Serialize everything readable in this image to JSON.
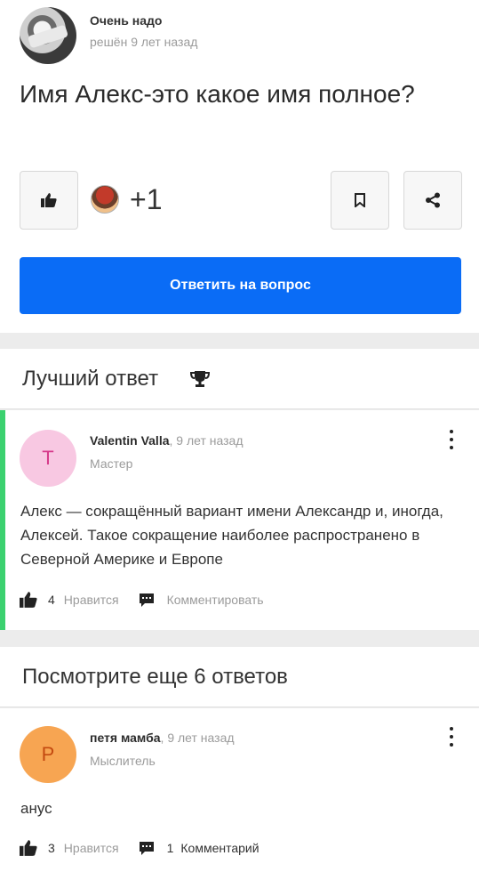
{
  "question": {
    "author": "Очень надо",
    "time": "решён 9 лет назад",
    "title": "Имя Алекс-это какое имя полное?",
    "likes_extra": "+1",
    "answer_button": "Ответить на вопрос"
  },
  "best": {
    "header": "Лучший ответ",
    "avatar_letter": "T",
    "author": "Valentin Valla",
    "time": ", 9 лет назад",
    "rank": "Мастер",
    "text": "Алекс — сокращённый вариант имени Александр и, иногда, Алексей. Такое сокращение наиболее распространено в Северной Америке и Европе",
    "like_count": "4",
    "like_label": "Нравится",
    "comment_label": "Комментировать"
  },
  "more": {
    "header": "Посмотрите еще 6 ответов"
  },
  "answer2": {
    "avatar_letter": "P",
    "author": "петя мамба",
    "time": ", 9 лет назад",
    "rank": "Мыслитель",
    "text": "анус",
    "like_count": "3",
    "like_label": "Нравится",
    "comment_count": "1",
    "comment_label": "Комментарий"
  },
  "colors": {
    "accent": "#0a6cf6",
    "best_bar": "#3bd16f"
  },
  "icons": [
    "thumbs-up-icon",
    "bookmark-icon",
    "share-icon",
    "trophy-icon",
    "comment-icon",
    "more-vertical-icon"
  ]
}
